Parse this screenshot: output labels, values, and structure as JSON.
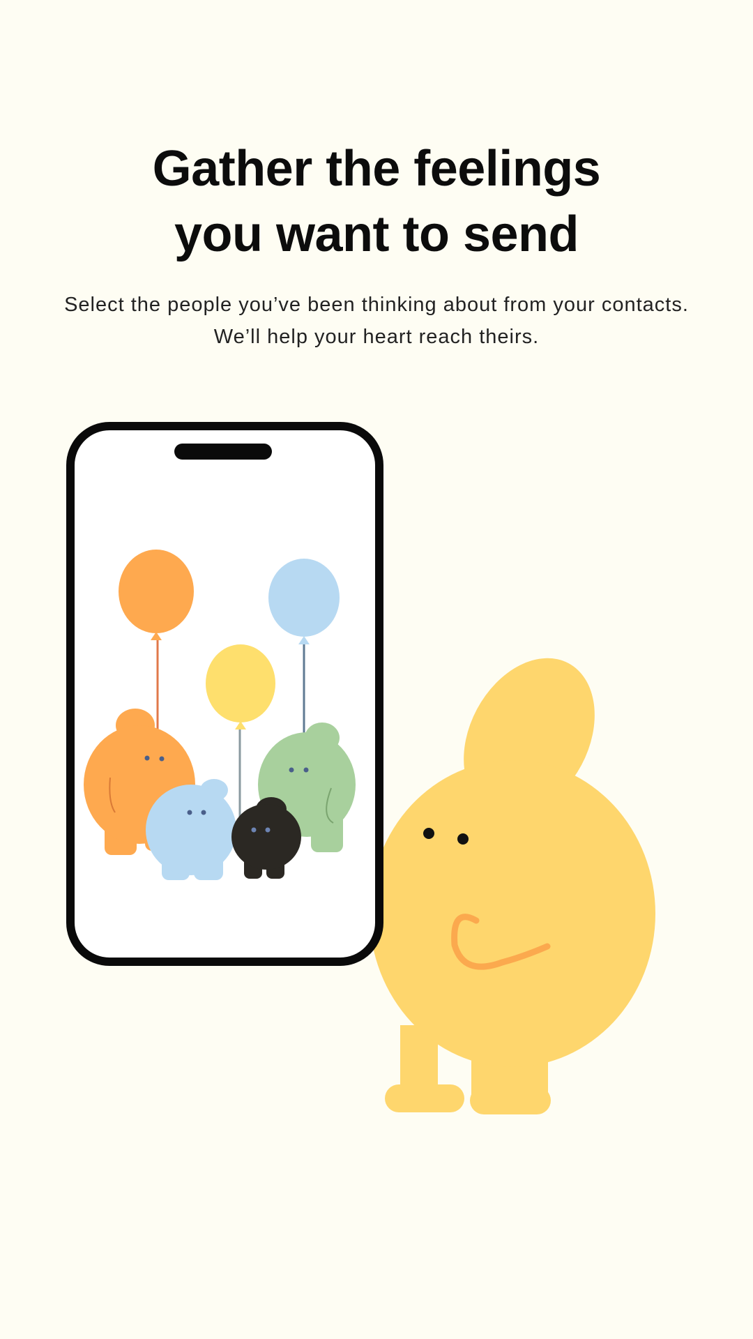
{
  "onboarding": {
    "title_line1": "Gather the feelings",
    "title_line2": "you want to send",
    "subtitle_line1": "Select the people you’ve been thinking about from your contacts.",
    "subtitle_line2": "We’ll help your heart reach theirs."
  },
  "illustration": {
    "phone_icon": "smartphone",
    "balloons": [
      "orange-balloon",
      "yellow-balloon",
      "blue-balloon"
    ],
    "characters": [
      "orange-creature",
      "blue-creature",
      "black-creature",
      "green-creature",
      "yellow-mascot"
    ]
  },
  "colors": {
    "background": "#fefdf3",
    "text": "#0c0c0c",
    "orange": "#fea94f",
    "yellow": "#fed66d",
    "blue": "#b7d9f2",
    "green": "#a8d09d",
    "dark": "#2b2823"
  }
}
